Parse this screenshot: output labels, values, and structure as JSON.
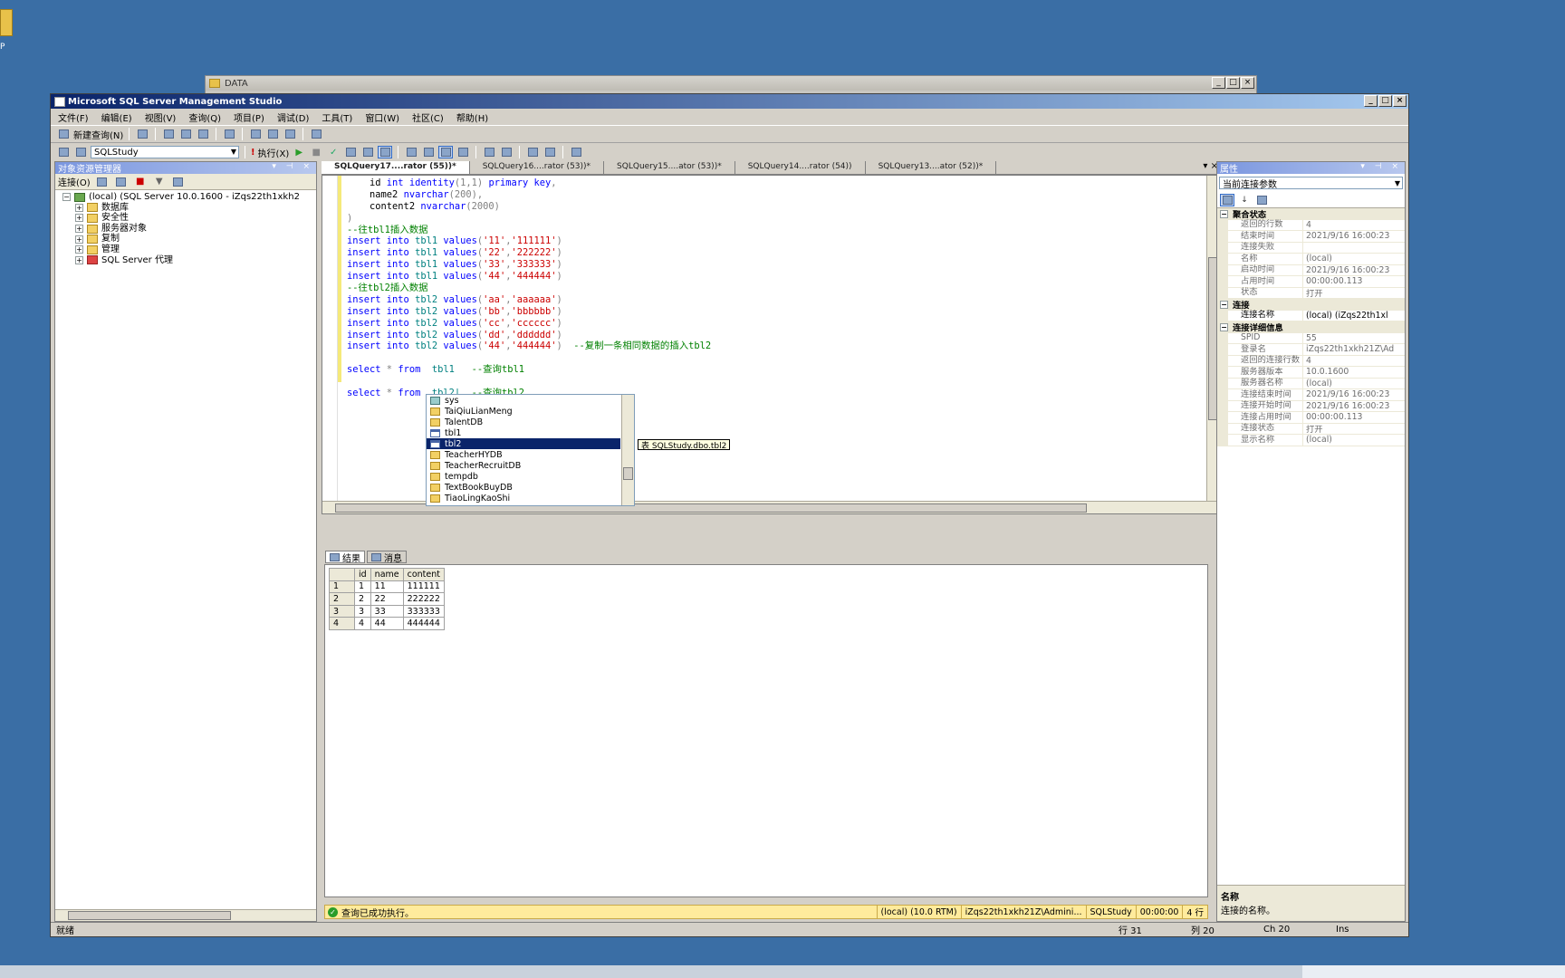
{
  "desktop": {
    "icon_label": "P"
  },
  "data_window": {
    "title": "DATA"
  },
  "window": {
    "title": "Microsoft SQL Server Management Studio"
  },
  "menu": [
    "文件(F)",
    "编辑(E)",
    "视图(V)",
    "查询(Q)",
    "项目(P)",
    "调试(D)",
    "工具(T)",
    "窗口(W)",
    "社区(C)",
    "帮助(H)"
  ],
  "toolbar": {
    "new_query": "新建查询(N)",
    "database": "SQLStudy",
    "execute": "执行(X)"
  },
  "object_explorer": {
    "title": "对象资源管理器",
    "connect": "连接(O)",
    "server": "(local) (SQL Server 10.0.1600 - iZqs22th1xkh2",
    "nodes": [
      "数据库",
      "安全性",
      "服务器对象",
      "复制",
      "管理",
      "SQL Server 代理"
    ]
  },
  "doc_tabs": [
    "SQLQuery17....rator (55))*",
    "SQLQuery16....rator (53))*",
    "SQLQuery15....ator (53))*",
    "SQLQuery14....rator (54))",
    "SQLQuery13....ator (52))*"
  ],
  "editor": {
    "lines": [
      [
        {
          "t": "    id ",
          "c": ""
        },
        {
          "t": "int",
          "c": "kw"
        },
        {
          "t": " ",
          "c": ""
        },
        {
          "t": "identity",
          "c": "kw"
        },
        {
          "t": "(1,1) ",
          "c": "gy"
        },
        {
          "t": "primary key",
          "c": "kw"
        },
        {
          "t": ",",
          "c": "gy"
        }
      ],
      [
        {
          "t": "    name2 ",
          "c": ""
        },
        {
          "t": "nvarchar",
          "c": "kw"
        },
        {
          "t": "(200),",
          "c": "gy"
        }
      ],
      [
        {
          "t": "    content2 ",
          "c": ""
        },
        {
          "t": "nvarchar",
          "c": "kw"
        },
        {
          "t": "(2000)",
          "c": "gy"
        }
      ],
      [
        {
          "t": ")",
          "c": "gy"
        }
      ],
      [
        {
          "t": "--往tbl1插入数据",
          "c": "cm"
        }
      ],
      [
        {
          "t": "insert into ",
          "c": "kw"
        },
        {
          "t": "tbl1 ",
          "c": "tbl"
        },
        {
          "t": "values",
          "c": "kw"
        },
        {
          "t": "(",
          "c": "gy"
        },
        {
          "t": "'11'",
          "c": "str"
        },
        {
          "t": ",",
          "c": "gy"
        },
        {
          "t": "'111111'",
          "c": "str"
        },
        {
          "t": ")",
          "c": "gy"
        }
      ],
      [
        {
          "t": "insert into ",
          "c": "kw"
        },
        {
          "t": "tbl1 ",
          "c": "tbl"
        },
        {
          "t": "values",
          "c": "kw"
        },
        {
          "t": "(",
          "c": "gy"
        },
        {
          "t": "'22'",
          "c": "str"
        },
        {
          "t": ",",
          "c": "gy"
        },
        {
          "t": "'222222'",
          "c": "str"
        },
        {
          "t": ")",
          "c": "gy"
        }
      ],
      [
        {
          "t": "insert into ",
          "c": "kw"
        },
        {
          "t": "tbl1 ",
          "c": "tbl"
        },
        {
          "t": "values",
          "c": "kw"
        },
        {
          "t": "(",
          "c": "gy"
        },
        {
          "t": "'33'",
          "c": "str"
        },
        {
          "t": ",",
          "c": "gy"
        },
        {
          "t": "'333333'",
          "c": "str"
        },
        {
          "t": ")",
          "c": "gy"
        }
      ],
      [
        {
          "t": "insert into ",
          "c": "kw"
        },
        {
          "t": "tbl1 ",
          "c": "tbl"
        },
        {
          "t": "values",
          "c": "kw"
        },
        {
          "t": "(",
          "c": "gy"
        },
        {
          "t": "'44'",
          "c": "str"
        },
        {
          "t": ",",
          "c": "gy"
        },
        {
          "t": "'444444'",
          "c": "str"
        },
        {
          "t": ")",
          "c": "gy"
        }
      ],
      [
        {
          "t": "--往tbl2插入数据",
          "c": "cm"
        }
      ],
      [
        {
          "t": "insert into ",
          "c": "kw"
        },
        {
          "t": "tbl2 ",
          "c": "tbl"
        },
        {
          "t": "values",
          "c": "kw"
        },
        {
          "t": "(",
          "c": "gy"
        },
        {
          "t": "'aa'",
          "c": "str"
        },
        {
          "t": ",",
          "c": "gy"
        },
        {
          "t": "'aaaaaa'",
          "c": "str"
        },
        {
          "t": ")",
          "c": "gy"
        }
      ],
      [
        {
          "t": "insert into ",
          "c": "kw"
        },
        {
          "t": "tbl2 ",
          "c": "tbl"
        },
        {
          "t": "values",
          "c": "kw"
        },
        {
          "t": "(",
          "c": "gy"
        },
        {
          "t": "'bb'",
          "c": "str"
        },
        {
          "t": ",",
          "c": "gy"
        },
        {
          "t": "'bbbbbb'",
          "c": "str"
        },
        {
          "t": ")",
          "c": "gy"
        }
      ],
      [
        {
          "t": "insert into ",
          "c": "kw"
        },
        {
          "t": "tbl2 ",
          "c": "tbl"
        },
        {
          "t": "values",
          "c": "kw"
        },
        {
          "t": "(",
          "c": "gy"
        },
        {
          "t": "'cc'",
          "c": "str"
        },
        {
          "t": ",",
          "c": "gy"
        },
        {
          "t": "'cccccc'",
          "c": "str"
        },
        {
          "t": ")",
          "c": "gy"
        }
      ],
      [
        {
          "t": "insert into ",
          "c": "kw"
        },
        {
          "t": "tbl2 ",
          "c": "tbl"
        },
        {
          "t": "values",
          "c": "kw"
        },
        {
          "t": "(",
          "c": "gy"
        },
        {
          "t": "'dd'",
          "c": "str"
        },
        {
          "t": ",",
          "c": "gy"
        },
        {
          "t": "'dddddd'",
          "c": "str"
        },
        {
          "t": ")",
          "c": "gy"
        }
      ],
      [
        {
          "t": "insert into ",
          "c": "kw"
        },
        {
          "t": "tbl2 ",
          "c": "tbl"
        },
        {
          "t": "values",
          "c": "kw"
        },
        {
          "t": "(",
          "c": "gy"
        },
        {
          "t": "'44'",
          "c": "str"
        },
        {
          "t": ",",
          "c": "gy"
        },
        {
          "t": "'444444'",
          "c": "str"
        },
        {
          "t": ")  ",
          "c": "gy"
        },
        {
          "t": "--复制一条相同数据的插入tbl2",
          "c": "cm"
        }
      ],
      [
        {
          "t": "",
          "c": ""
        }
      ],
      [
        {
          "t": "select ",
          "c": "kw"
        },
        {
          "t": "* ",
          "c": "gy"
        },
        {
          "t": "from  ",
          "c": "kw"
        },
        {
          "t": "tbl1   ",
          "c": "tbl"
        },
        {
          "t": "--查询tbl1",
          "c": "cm"
        }
      ],
      [
        {
          "t": "",
          "c": ""
        }
      ],
      [
        {
          "t": "select ",
          "c": "kw"
        },
        {
          "t": "* ",
          "c": "gy"
        },
        {
          "t": "from  ",
          "c": "kw"
        },
        {
          "t": "tbl2|  ",
          "c": "tbl"
        },
        {
          "t": "--查询tbl2",
          "c": "cm"
        }
      ]
    ]
  },
  "autocomplete": {
    "items": [
      {
        "label": "sys",
        "icon": "schema"
      },
      {
        "label": "TaiQiuLianMeng",
        "icon": "database"
      },
      {
        "label": "TalentDB",
        "icon": "database"
      },
      {
        "label": "tbl1",
        "icon": "table"
      },
      {
        "label": "tbl2",
        "icon": "table",
        "selected": true
      },
      {
        "label": "TeacherHYDB",
        "icon": "database"
      },
      {
        "label": "TeacherRecruitDB",
        "icon": "database"
      },
      {
        "label": "tempdb",
        "icon": "database"
      },
      {
        "label": "TextBookBuyDB",
        "icon": "database"
      },
      {
        "label": "TiaoLingKaoShi",
        "icon": "database"
      }
    ],
    "tooltip": "表 SQLStudy.dbo.tbl2"
  },
  "results": {
    "tab_results": "结果",
    "tab_messages": "消息",
    "columns": [
      "id",
      "name",
      "content"
    ],
    "rows": [
      [
        "1",
        "11",
        "111111"
      ],
      [
        "2",
        "22",
        "222222"
      ],
      [
        "3",
        "33",
        "333333"
      ],
      [
        "4",
        "44",
        "444444"
      ]
    ]
  },
  "exec_status": {
    "message": "查询已成功执行。",
    "server": "(local) (10.0 RTM)",
    "user": "iZqs22th1xkh21Z\\Admini...",
    "db": "SQLStudy",
    "time": "00:00:00",
    "rows": "4 行"
  },
  "properties": {
    "title": "属性",
    "combo": "当前连接参数",
    "sections": [
      {
        "name": "聚合状态",
        "rows": [
          [
            "返回的行数",
            "4"
          ],
          [
            "结束时间",
            "2021/9/16 16:00:23"
          ],
          [
            "连接失败",
            ""
          ],
          [
            "名称",
            "(local)"
          ],
          [
            "启动时间",
            "2021/9/16 16:00:23"
          ],
          [
            "占用时间",
            "00:00:00.113"
          ],
          [
            "状态",
            "打开"
          ]
        ]
      },
      {
        "name": "连接",
        "rows": [
          [
            "连接名称",
            "(local) (iZqs22th1xl"
          ]
        ],
        "dark": true
      },
      {
        "name": "连接详细信息",
        "rows": [
          [
            "SPID",
            "55"
          ],
          [
            "登录名",
            "iZqs22th1xkh21Z\\Adm"
          ],
          [
            "返回的连接行数",
            "4"
          ],
          [
            "服务器版本",
            "10.0.1600"
          ],
          [
            "服务器名称",
            "(local)"
          ],
          [
            "连接结束时间",
            "2021/9/16 16:00:23"
          ],
          [
            "连接开始时间",
            "2021/9/16 16:00:23"
          ],
          [
            "连接占用时间",
            "00:00:00.113"
          ],
          [
            "连接状态",
            "打开"
          ],
          [
            "显示名称",
            "(local)"
          ]
        ]
      }
    ],
    "desc_title": "名称",
    "desc_text": "连接的名称。"
  },
  "statusbar": {
    "left": "就绪",
    "line": "行 31",
    "col": "列 20",
    "ch": "Ch 20",
    "mode": "Ins"
  }
}
